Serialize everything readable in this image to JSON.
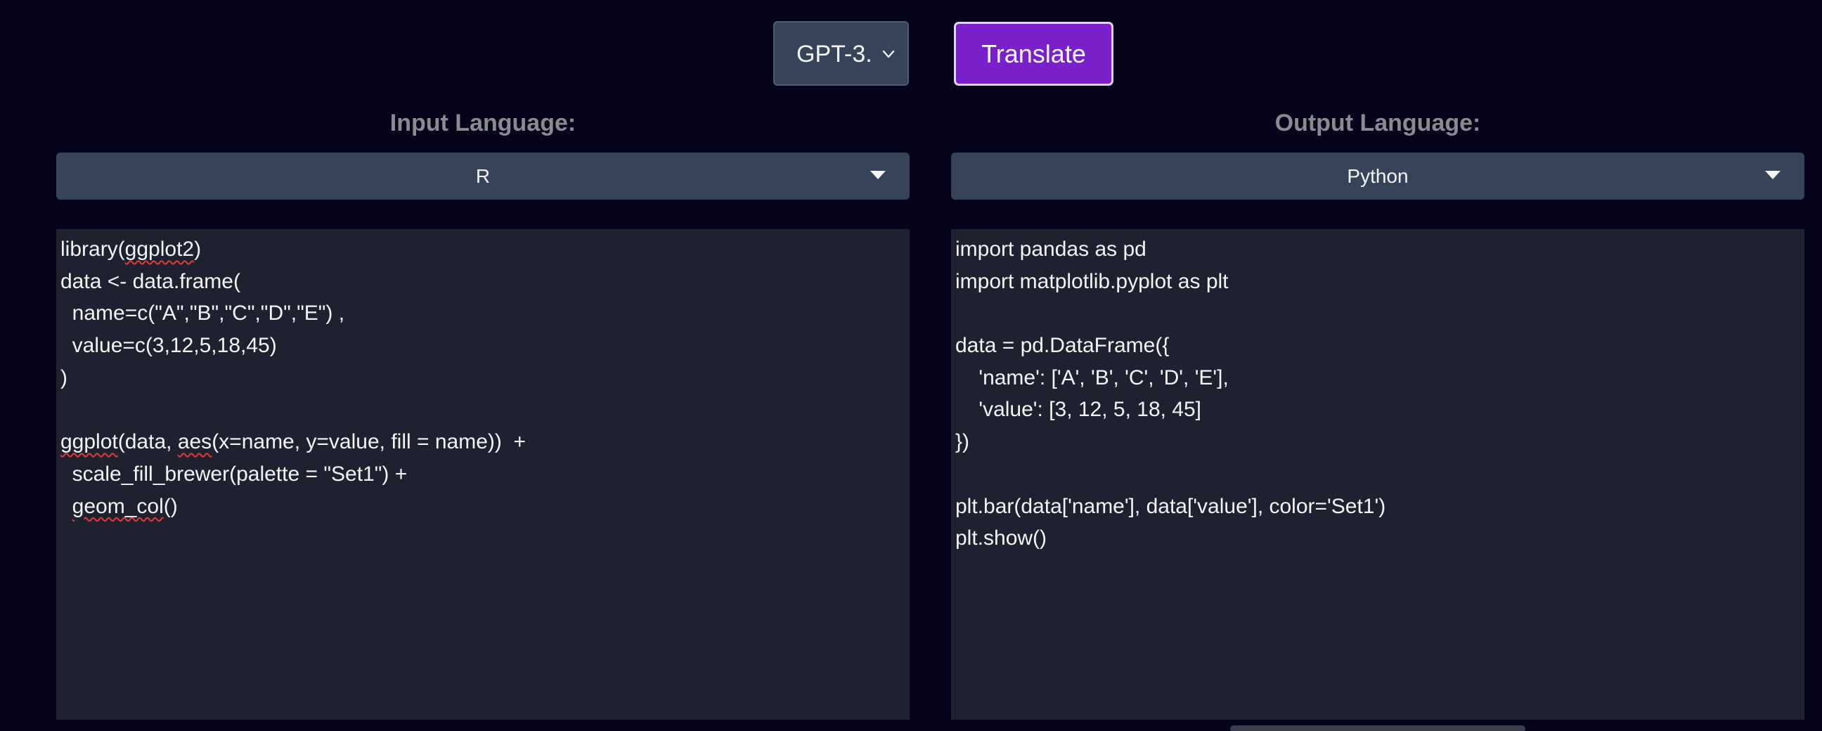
{
  "toolbar": {
    "model_value": "GPT-3.",
    "translate_label": "Translate"
  },
  "input": {
    "label": "Input Language:",
    "language": "R",
    "lines": [
      {
        "segments": [
          {
            "text": "library("
          },
          {
            "text": "ggplot2",
            "spell": true
          },
          {
            "text": ")"
          }
        ]
      },
      {
        "segments": [
          {
            "text": "data <- data.frame("
          }
        ]
      },
      {
        "segments": [
          {
            "text": "  name=c(\"A\",\"B\",\"C\",\"D\",\"E\") ,"
          }
        ]
      },
      {
        "segments": [
          {
            "text": "  value=c(3,12,5,18,45)"
          }
        ]
      },
      {
        "segments": [
          {
            "text": ")"
          }
        ]
      },
      {
        "segments": [
          {
            "text": ""
          }
        ]
      },
      {
        "segments": [
          {
            "text": "ggplot",
            "spell": true
          },
          {
            "text": "(data, "
          },
          {
            "text": "aes",
            "spell": true
          },
          {
            "text": "(x=name, y=value, fill = name))  +"
          }
        ]
      },
      {
        "segments": [
          {
            "text": "  scale_fill_brewer(palette = \"Set1\") +"
          }
        ]
      },
      {
        "segments": [
          {
            "text": "  "
          },
          {
            "text": "geom_col",
            "spell": true
          },
          {
            "text": "()"
          }
        ]
      }
    ]
  },
  "output": {
    "label": "Output Language:",
    "language": "Python",
    "lines": [
      {
        "segments": [
          {
            "text": "import pandas as pd"
          }
        ]
      },
      {
        "segments": [
          {
            "text": "import matplotlib.pyplot as plt"
          }
        ]
      },
      {
        "segments": [
          {
            "text": ""
          }
        ]
      },
      {
        "segments": [
          {
            "text": "data = pd.DataFrame({"
          }
        ]
      },
      {
        "segments": [
          {
            "text": "    'name': ['A', 'B', 'C', 'D', 'E'],"
          }
        ]
      },
      {
        "segments": [
          {
            "text": "    'value': [3, 12, 5, 18, 45]"
          }
        ]
      },
      {
        "segments": [
          {
            "text": "})"
          }
        ]
      },
      {
        "segments": [
          {
            "text": ""
          }
        ]
      },
      {
        "segments": [
          {
            "text": "plt.bar(data['name'], data['value'], color='Set1')"
          }
        ]
      },
      {
        "segments": [
          {
            "text": "plt.show()"
          }
        ]
      }
    ]
  },
  "colors": {
    "background": "#05041a",
    "control": "#354459",
    "accent": "#7a1fcc",
    "pane": "#1f2130",
    "label": "#8a8a92",
    "spellcheck": "#e03a3a"
  },
  "icons": {
    "model_chevron": "chevron-down-icon",
    "dropdown_caret": "caret-down-icon"
  }
}
